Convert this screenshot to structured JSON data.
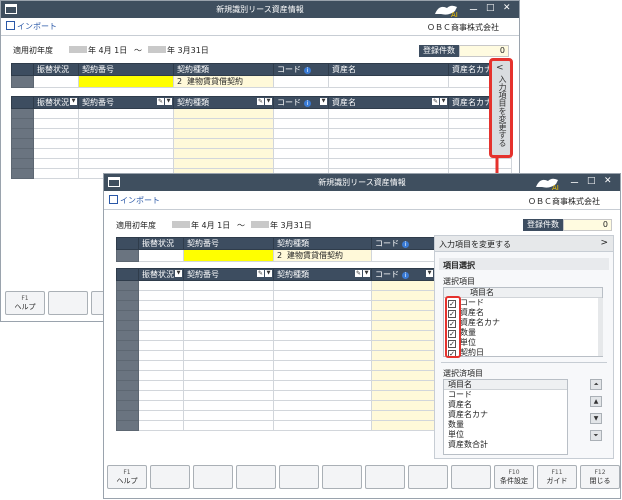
{
  "app": {
    "title": "新規識別リース資産情報",
    "company": "ＯＢＣ商事株式会社",
    "import_label": "インポート",
    "window_controls": [
      "ー",
      "□",
      "✕"
    ]
  },
  "form": {
    "year_label": "適用初年度",
    "date_start": "年  4月  1日",
    "tilde": "～",
    "date_end": "年  3月31日",
    "count_label": "登録件数",
    "count_value": "0"
  },
  "top_grid": {
    "headers": [
      "振替状況",
      "契約番号",
      "契約種類",
      "コード",
      "資産名",
      "資産名カナ"
    ],
    "row": {
      "type_code": "2",
      "type_name": "建物賃貸借契約"
    }
  },
  "list_grid": {
    "headers": [
      "振替状況",
      "契約番号",
      "契約種類",
      "コード",
      "資産名",
      "資産名カナ"
    ]
  },
  "side_tab": {
    "label": "入力項目を変更する",
    "chevron": "<"
  },
  "panel": {
    "title": "入力項目を変更する",
    "arrow": ">",
    "section_title": "項目選択",
    "selection_label": "選択項目",
    "selection_header": "項目名",
    "selection_items": [
      "コード",
      "資産名",
      "資産名カナ",
      "数量",
      "単位",
      "契約日"
    ],
    "selected_label": "選択済項目",
    "selected_header": "項目名",
    "selected_items": [
      "コード",
      "資産名",
      "資産名カナ",
      "数量",
      "単位",
      "資産数合計"
    ]
  },
  "fkeys_back": [
    {
      "n": "F1",
      "label": "ヘルプ"
    },
    {
      "n": "",
      "label": ""
    },
    {
      "n": "",
      "label": ""
    }
  ],
  "fkeys_front": [
    {
      "n": "F1",
      "label": "ヘルプ"
    },
    {
      "n": "",
      "label": ""
    },
    {
      "n": "",
      "label": ""
    },
    {
      "n": "",
      "label": ""
    },
    {
      "n": "",
      "label": ""
    },
    {
      "n": "",
      "label": ""
    },
    {
      "n": "",
      "label": ""
    },
    {
      "n": "",
      "label": ""
    },
    {
      "n": "",
      "label": ""
    },
    {
      "n": "F10",
      "label": "条件設定"
    },
    {
      "n": "F11",
      "label": "ガイド"
    },
    {
      "n": "F12",
      "label": "閉じる"
    }
  ],
  "colors": {
    "accent": "#3d4d60",
    "highlight": "#e5322d",
    "input": "#ffff00"
  }
}
